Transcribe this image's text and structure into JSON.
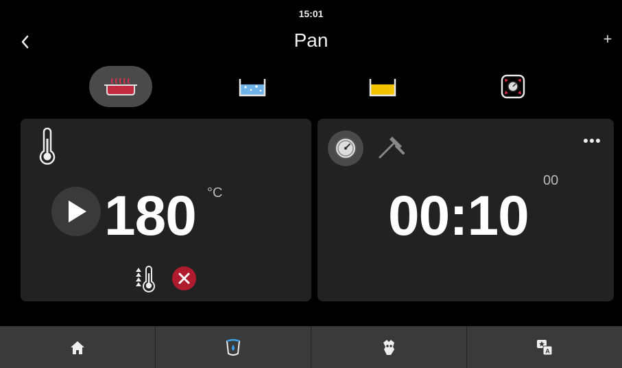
{
  "status": {
    "time": "15:01"
  },
  "header": {
    "title": "Pan",
    "back_icon": "chevron-left-icon",
    "add_label": "+"
  },
  "mode_tabs": [
    {
      "icon": "pan-heating-icon",
      "active": true
    },
    {
      "icon": "water-bath-icon",
      "active": false
    },
    {
      "icon": "oil-bath-icon",
      "active": false
    },
    {
      "icon": "pressure-cooking-icon",
      "active": false
    }
  ],
  "temperature": {
    "value": "180",
    "unit": "°C",
    "accent": "#b01c2e"
  },
  "timer": {
    "value": "00:10",
    "seconds": "00"
  },
  "bottom_nav": [
    {
      "icon": "home-icon"
    },
    {
      "icon": "cleaning-icon"
    },
    {
      "icon": "service-icon"
    },
    {
      "icon": "language-icon"
    }
  ]
}
